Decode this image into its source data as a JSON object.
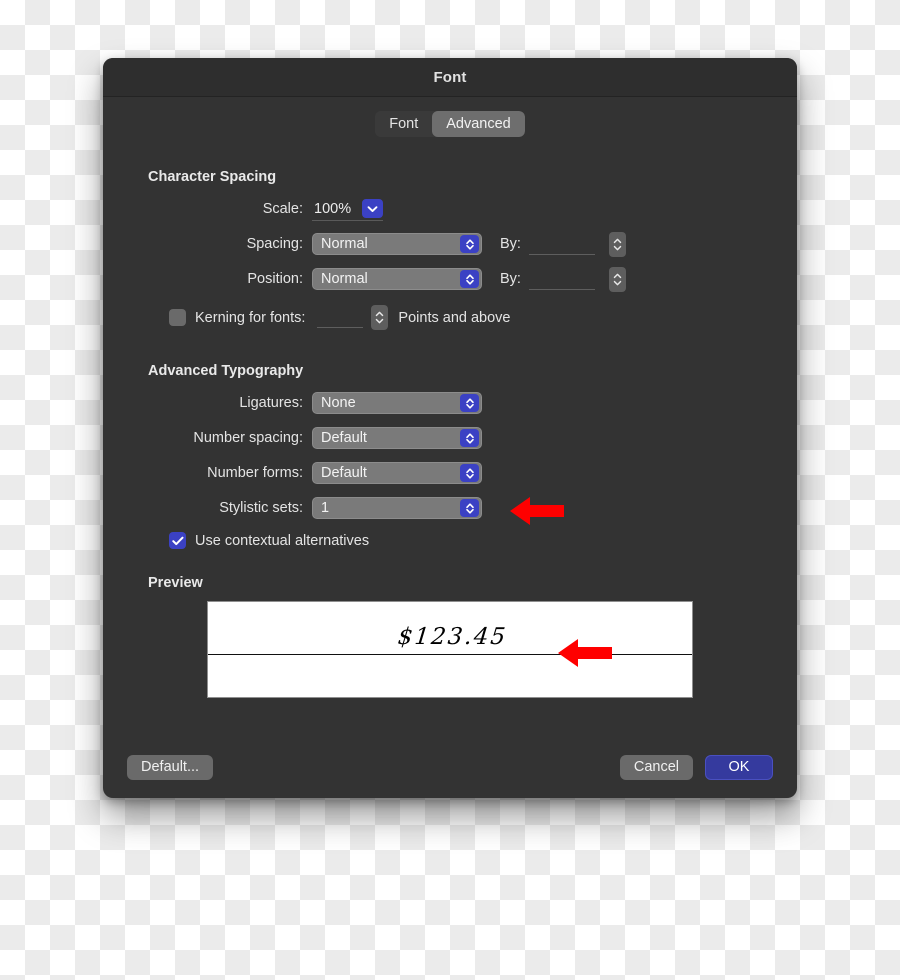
{
  "window": {
    "title": "Font"
  },
  "tabs": [
    {
      "label": "Font",
      "selected": false
    },
    {
      "label": "Advanced",
      "selected": true
    }
  ],
  "sections": {
    "character_spacing": {
      "heading": "Character Spacing",
      "scale": {
        "label": "Scale:",
        "value": "100%",
        "icon": "chevron-down-icon"
      },
      "spacing": {
        "label": "Spacing:",
        "value": "Normal",
        "by_label": "By:",
        "by_value": ""
      },
      "position": {
        "label": "Position:",
        "value": "Normal",
        "by_label": "By:",
        "by_value": ""
      },
      "kerning": {
        "label": "Kerning for fonts:",
        "checked": false,
        "value": "",
        "suffix": "Points and above"
      }
    },
    "advanced_typography": {
      "heading": "Advanced Typography",
      "ligatures": {
        "label": "Ligatures:",
        "value": "None"
      },
      "number_spacing": {
        "label": "Number spacing:",
        "value": "Default"
      },
      "number_forms": {
        "label": "Number forms:",
        "value": "Default"
      },
      "stylistic_sets": {
        "label": "Stylistic sets:",
        "value": "1"
      },
      "contextual_alternates": {
        "label": "Use contextual alternatives",
        "checked": true
      }
    },
    "preview": {
      "heading": "Preview",
      "sample_text": "$123.45"
    }
  },
  "footer": {
    "default_label": "Default...",
    "cancel_label": "Cancel",
    "ok_label": "OK"
  },
  "annotations": [
    {
      "name": "arrow-pointing-at-stylistic-sets",
      "direction": "left",
      "color": "#FF0000"
    },
    {
      "name": "arrow-pointing-at-preview-text",
      "direction": "left",
      "color": "#FF0000"
    }
  ],
  "colors": {
    "window_bg": "#333333",
    "titlebar_bg": "#2e2e2e",
    "popup_gray": "#7a7a7a",
    "accent_blue": "#3b41c4",
    "ok_blue": "#353a9e",
    "annotation_red": "#FF0000"
  }
}
